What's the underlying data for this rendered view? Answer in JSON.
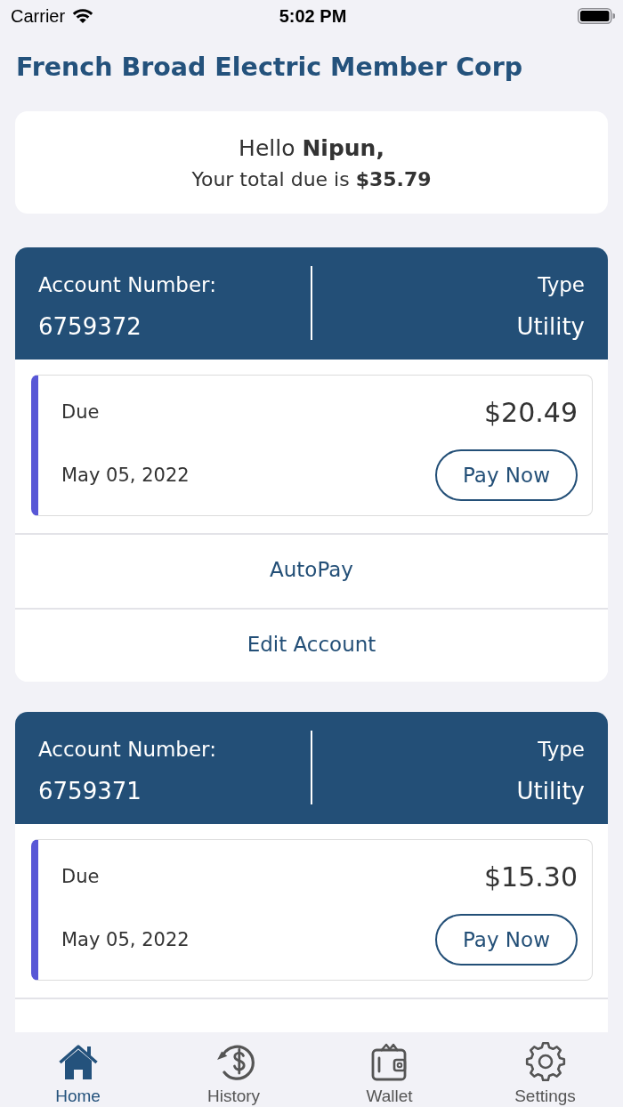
{
  "status_bar": {
    "carrier": "Carrier",
    "time": "5:02 PM"
  },
  "header": {
    "title": "French Broad Electric Member Corp"
  },
  "greeting": {
    "hello": "Hello **Nipun,**",
    "total": "Your total due is **$35.79**"
  },
  "accounts": [
    {
      "number_label": "Account Number:",
      "number": "6759372",
      "type_label": "Type",
      "type": "Utility",
      "due_label": "Due",
      "amount": "$20.49",
      "due_date": "May 05, 2022",
      "pay_button": "Pay Now",
      "actions": [
        "AutoPay",
        "Edit Account"
      ]
    },
    {
      "number_label": "Account Number:",
      "number": "6759371",
      "type_label": "Type",
      "type": "Utility",
      "due_label": "Due",
      "amount": "$15.30",
      "due_date": "May 05, 2022",
      "pay_button": "Pay Now"
    }
  ],
  "tab_bar": [
    {
      "label": "Home",
      "selected": true
    },
    {
      "label": "History",
      "selected": false
    },
    {
      "label": "Wallet",
      "selected": false
    },
    {
      "label": "Settings",
      "selected": false
    }
  ]
}
